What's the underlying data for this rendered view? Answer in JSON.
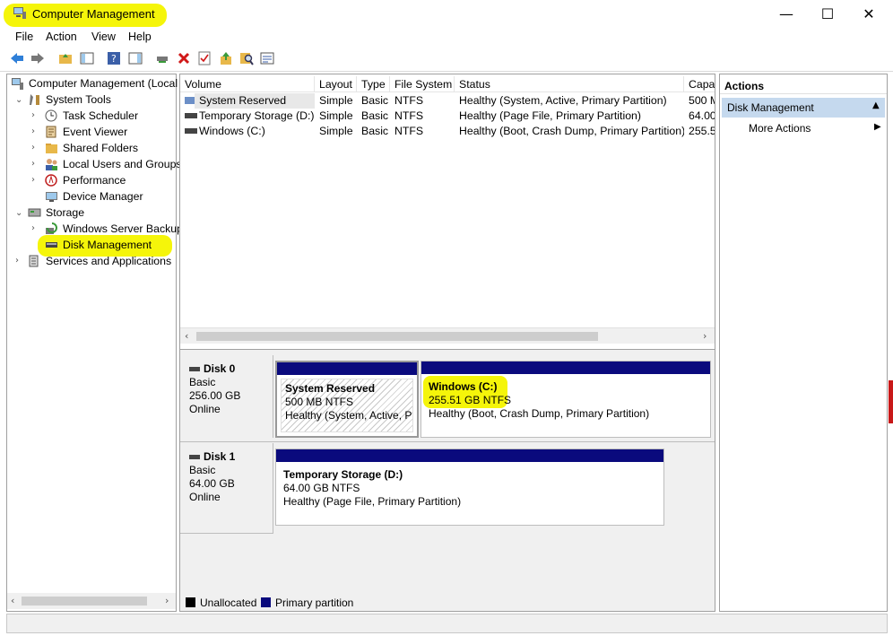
{
  "window": {
    "title": "Computer Management",
    "minimize": "—",
    "maximize": "☐",
    "close": "✕"
  },
  "menu": {
    "file": "File",
    "action": "Action",
    "view": "View",
    "help": "Help"
  },
  "tree": {
    "root": "Computer Management (Local",
    "system_tools": "System Tools",
    "task_scheduler": "Task Scheduler",
    "event_viewer": "Event Viewer",
    "shared_folders": "Shared Folders",
    "local_users": "Local Users and Groups",
    "performance": "Performance",
    "device_manager": "Device Manager",
    "storage": "Storage",
    "wsb": "Windows Server Backup",
    "disk_mgmt": "Disk Management",
    "services": "Services and Applications"
  },
  "volumes": {
    "columns": [
      "Volume",
      "Layout",
      "Type",
      "File System",
      "Status",
      "Capa"
    ],
    "rows": [
      [
        "System Reserved",
        "Simple",
        "Basic",
        "NTFS",
        "Healthy (System, Active, Primary Partition)",
        "500 M"
      ],
      [
        "Temporary Storage (D:)",
        "Simple",
        "Basic",
        "NTFS",
        "Healthy (Page File, Primary Partition)",
        "64.00"
      ],
      [
        "Windows (C:)",
        "Simple",
        "Basic",
        "NTFS",
        "Healthy (Boot, Crash Dump, Primary Partition)",
        "255.5"
      ]
    ]
  },
  "disks": {
    "disk0": {
      "name": "Disk 0",
      "type": "Basic",
      "size": "256.00 GB",
      "status": "Online"
    },
    "disk1": {
      "name": "Disk 1",
      "type": "Basic",
      "size": "64.00 GB",
      "status": "Online"
    },
    "p_sysres": {
      "name": "System Reserved",
      "size": "500 MB NTFS",
      "status": "Healthy (System, Active, Pri"
    },
    "p_win": {
      "name": "Windows  (C:)",
      "size": "255.51 GB NTFS",
      "status": "Healthy (Boot, Crash Dump, Primary Partition)"
    },
    "p_temp": {
      "name": "Temporary Storage  (D:)",
      "size": "64.00 GB NTFS",
      "status": "Healthy (Page File, Primary Partition)"
    }
  },
  "legend": {
    "unallocated": "Unallocated",
    "primary": "Primary partition"
  },
  "actions": {
    "header": "Actions",
    "section": "Disk Management",
    "more": "More Actions"
  },
  "colors": {
    "highlight": "#f5f50a",
    "partition_bar": "#0a0a7d",
    "selected_section": "#c5d9ee"
  }
}
